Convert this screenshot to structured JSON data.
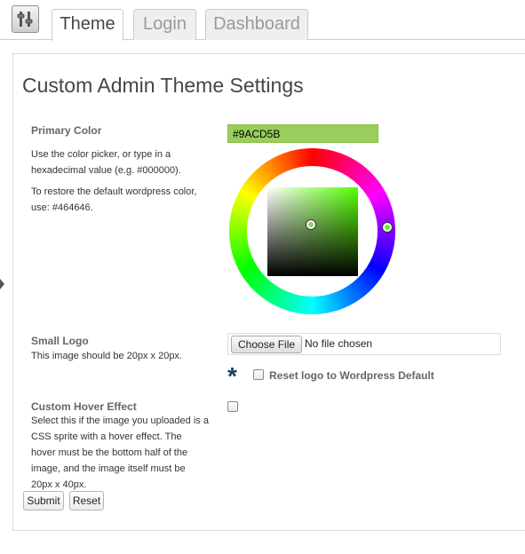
{
  "tabs": [
    {
      "label": "Theme",
      "active": true
    },
    {
      "label": "Login",
      "active": false
    },
    {
      "label": "Dashboard",
      "active": false
    }
  ],
  "page_title": "Custom Admin Theme Settings",
  "primary_color": {
    "label": "Primary Color",
    "description_1": "Use the color picker, or type in a hexadecimal value (e.g. #000000).",
    "description_2": "To restore the default wordpress color, use: #464646.",
    "value": "#9ACD5B"
  },
  "small_logo": {
    "label": "Small Logo",
    "description": "This image should be 20px x 20px.",
    "choose_button": "Choose File",
    "file_status": "No file chosen",
    "reset_label": "Reset logo to Wordpress Default",
    "reset_checked": false
  },
  "hover_effect": {
    "label": "Custom Hover Effect",
    "description": "Select this if the image you uploaded is a CSS sprite with a hover effect. The hover must be the bottom half of the image, and the image itself must be 20px x 40px.",
    "checked": false
  },
  "buttons": {
    "submit": "Submit",
    "reset": "Reset"
  },
  "colors": {
    "accent": "#9ACD5B",
    "title_text": "#464646",
    "asterisk": "#1a3f6b"
  },
  "icons": [
    "settings-sliders-icon",
    "asterisk-icon",
    "triangle-right-icon"
  ]
}
